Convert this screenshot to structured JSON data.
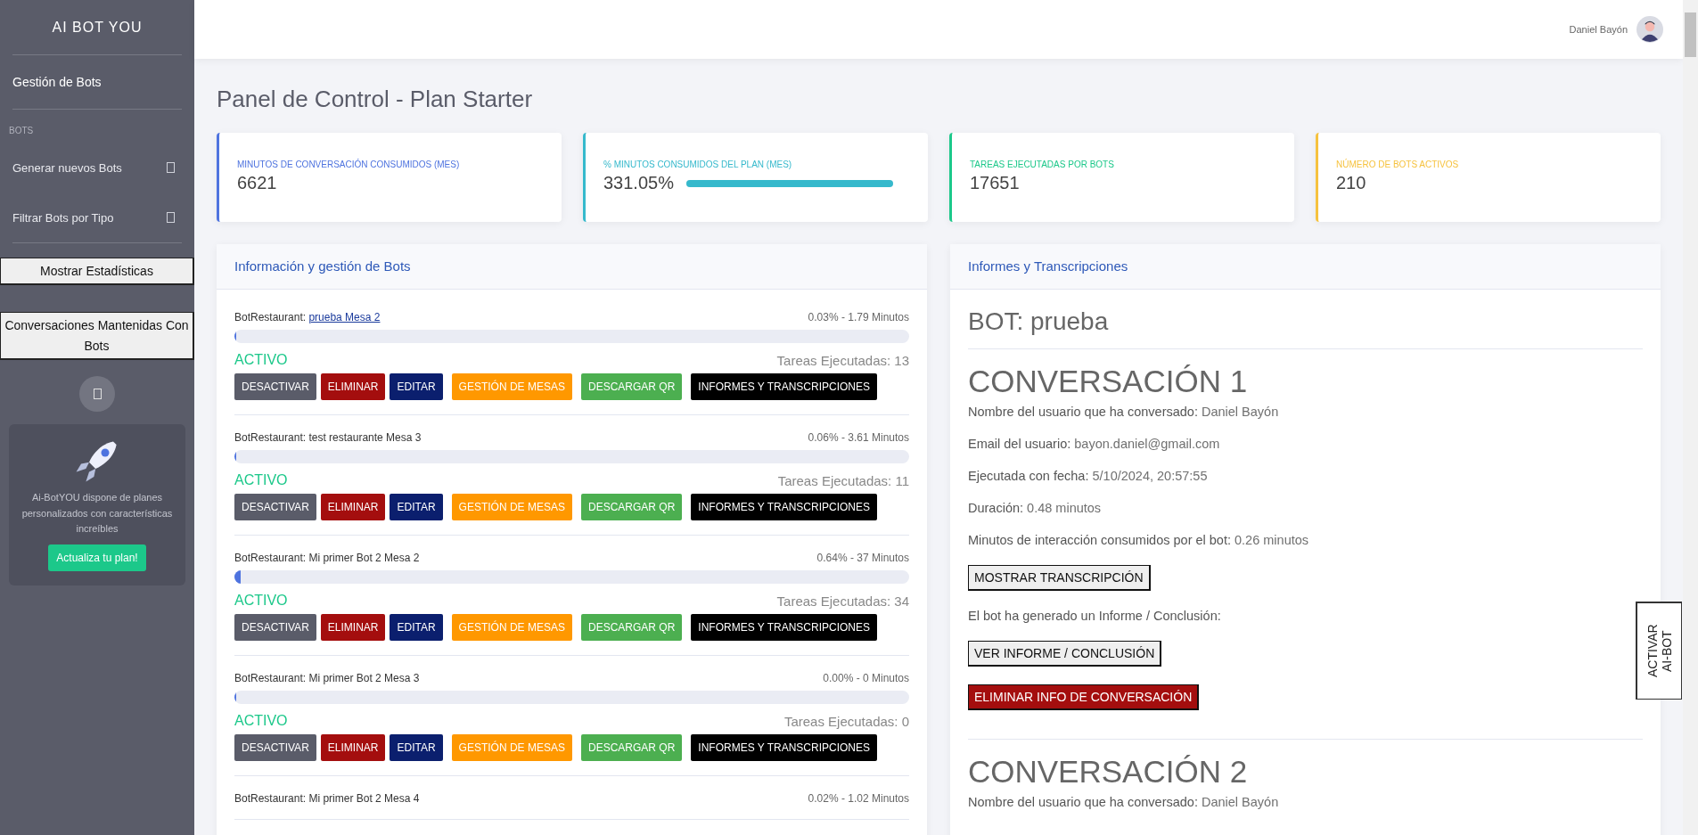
{
  "sidebar": {
    "brand": "AI BOT YOU",
    "items": [
      {
        "kind": "link",
        "label": "Gestión de Bots"
      },
      {
        "kind": "heading",
        "label": "BOTS"
      },
      {
        "kind": "collapse",
        "label": "Generar nuevos Bots"
      },
      {
        "kind": "collapse",
        "label": "Filtrar Bots por Tipo"
      },
      {
        "kind": "boxed",
        "label": "Mostrar Estadísticas"
      },
      {
        "kind": "boxed",
        "label": "Conversaciones Mantenidas Con Bots"
      }
    ],
    "promo": {
      "text": "Ai-BotYOU dispone de planes personalizados con características increíbles",
      "button": "Actualiza tu plan!"
    }
  },
  "topbar": {
    "user": "Daniel Bayón"
  },
  "page_title": "Panel de Control - Plan Starter",
  "stats": [
    {
      "label": "MINUTOS DE CONVERSACIÓN CONSUMIDOS (MES)",
      "value": "6621",
      "color": "#4e73df"
    },
    {
      "label": "% MINUTOS CONSUMIDOS DEL PLAN (MES)",
      "value": "331.05%",
      "color": "#36b9cc",
      "level": 1
    },
    {
      "label": "TAREAS EJECUTADAS POR BOTS",
      "value": "17651",
      "color": "#1cc88a"
    },
    {
      "label": "NÚMERO DE BOTS ACTIVOS",
      "value": "210",
      "color": "#f6c23e"
    }
  ],
  "bots_panel": {
    "title": "Información y gestión de Bots",
    "bots": [
      {
        "type": "BotRestaurant:",
        "name": "prueba Mesa 2",
        "linked": true,
        "usage": "0.03% - 1.79 Minutos",
        "level": 0.003,
        "status": "ACTIVO",
        "tasks": "Tareas Ejecutadas: 13",
        "buttons": [
          "DESACTIVAR",
          "ELIMINAR",
          "EDITAR",
          "GESTIÓN DE MESAS",
          "DESCARGAR QR",
          "INFORMES Y TRANSCRIPCIONES"
        ]
      },
      {
        "type": "BotRestaurant:",
        "name": "test restaurante Mesa 3",
        "linked": false,
        "usage": "0.06% - 3.61 Minutos",
        "level": 0.003,
        "status": "ACTIVO",
        "tasks": "Tareas Ejecutadas: 11",
        "buttons": [
          "DESACTIVAR",
          "ELIMINAR",
          "EDITAR",
          "GESTIÓN DE MESAS",
          "DESCARGAR QR",
          "INFORMES Y TRANSCRIPCIONES"
        ]
      },
      {
        "type": "BotRestaurant:",
        "name": "Mi primer Bot 2 Mesa 2",
        "linked": false,
        "usage": "0.64% - 37 Minutos",
        "level": 0.009,
        "status": "ACTIVO",
        "tasks": "Tareas Ejecutadas: 34",
        "buttons": [
          "DESACTIVAR",
          "ELIMINAR",
          "EDITAR",
          "GESTIÓN DE MESAS",
          "DESCARGAR QR",
          "INFORMES Y TRANSCRIPCIONES"
        ]
      },
      {
        "type": "BotRestaurant:",
        "name": "Mi primer Bot 2 Mesa 3",
        "linked": false,
        "usage": "0.00% - 0 Minutos",
        "level": 0,
        "status": "ACTIVO",
        "tasks": "Tareas Ejecutadas: 0",
        "buttons": [
          "DESACTIVAR",
          "ELIMINAR",
          "EDITAR",
          "GESTIÓN DE MESAS",
          "DESCARGAR QR",
          "INFORMES Y TRANSCRIPCIONES"
        ]
      },
      {
        "type": "BotRestaurant:",
        "name": "Mi primer Bot 2 Mesa 4",
        "linked": false,
        "usage": "0.02% - 1.02 Minutos"
      }
    ]
  },
  "reports_panel": {
    "title": "Informes y Transcripciones",
    "bot_title": "BOT: prueba",
    "conversations": [
      {
        "heading": "CONVERSACIÓN 1",
        "fields": [
          {
            "label": "Nombre del usuario que ha conversado:",
            "value": "Daniel Bayón"
          },
          {
            "label": "Email del usuario:",
            "value": "bayon.daniel@gmail.com"
          },
          {
            "label": "Ejecutada con fecha:",
            "value": "5/10/2024, 20:57:55"
          },
          {
            "label": "Duración:",
            "value": "0.48 minutos"
          },
          {
            "label": "Minutos de interacción consumidos por el bot:",
            "value": "0.26 minutos"
          }
        ],
        "transcript_button": "MOSTRAR TRANSCRIPCIÓN",
        "report_note": "El bot ha generado un Informe / Conclusión:",
        "report_button": "VER INFORME / CONCLUSIÓN",
        "delete_button": "ELIMINAR INFO DE CONVERSACIÓN"
      },
      {
        "heading": "CONVERSACIÓN 2",
        "fields": [
          {
            "label": "Nombre del usuario que ha conversado:",
            "value": "Daniel Bayón"
          }
        ]
      }
    ]
  },
  "floating_tab": [
    "ACTIVAR",
    "AI-BOT"
  ]
}
